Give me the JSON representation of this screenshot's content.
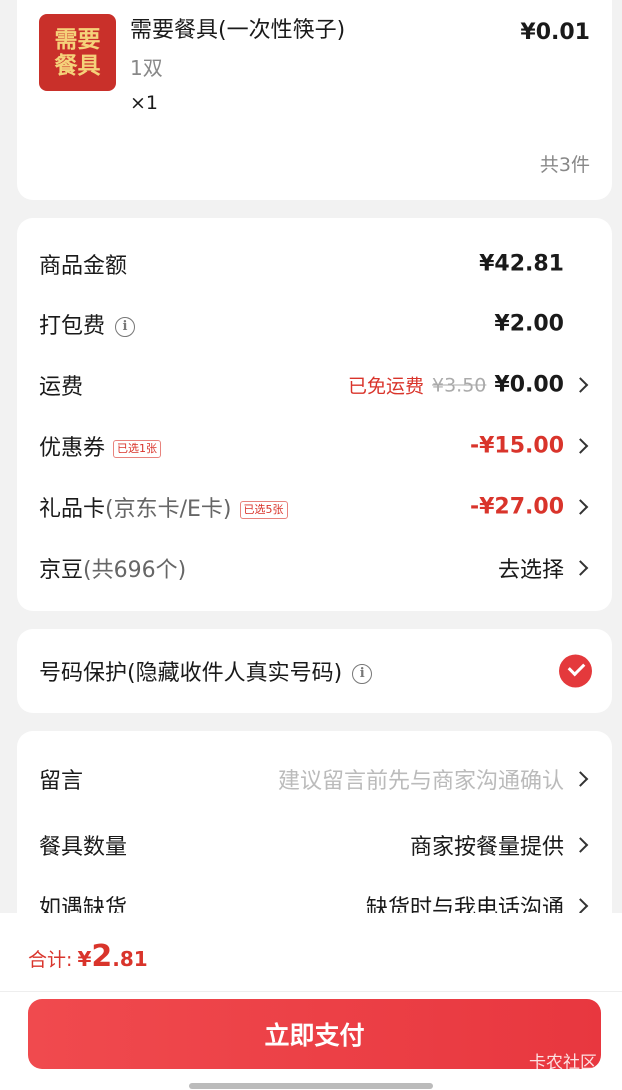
{
  "item": {
    "thumb_line1": "需要",
    "thumb_line2": "餐具",
    "name": "需要餐具(一次性筷子)",
    "spec": "1双",
    "qty": "×1",
    "price": "¥0.01",
    "total_count": "共3件"
  },
  "summary": {
    "goods_label": "商品金额",
    "goods_value": "¥42.81",
    "packing_label": "打包费",
    "packing_value": "¥2.00",
    "shipping_label": "运费",
    "shipping_free": "已免运费",
    "shipping_original": "¥3.50",
    "shipping_value": "¥0.00",
    "coupon_label": "优惠券",
    "coupon_tag": "已选1张",
    "coupon_value": "-¥15.00",
    "giftcard_label": "礼品卡",
    "giftcard_sub": "(京东卡/E卡)",
    "giftcard_tag": "已选5张",
    "giftcard_value": "-¥27.00",
    "jingdou_label": "京豆",
    "jingdou_sub": "(共696个)",
    "jingdou_value": "去选择"
  },
  "privacy": {
    "label": "号码保护(隐藏收件人真实号码)",
    "checked": true
  },
  "notes": {
    "message_label": "留言",
    "message_placeholder": "建议留言前先与商家沟通确认",
    "tableware_label": "餐具数量",
    "tableware_value": "商家按餐量提供",
    "stockout_label": "如遇缺货",
    "stockout_value": "缺货时与我电话沟通"
  },
  "footer": {
    "total_label": "合计:",
    "total_currency": "¥",
    "total_int": "2",
    "total_dec": ".81",
    "pay_label": "立即支付",
    "watermark": "卡农社区"
  },
  "colors": {
    "accent": "#e4393c",
    "price_red": "#d9342b",
    "background": "#f2f2f2"
  }
}
